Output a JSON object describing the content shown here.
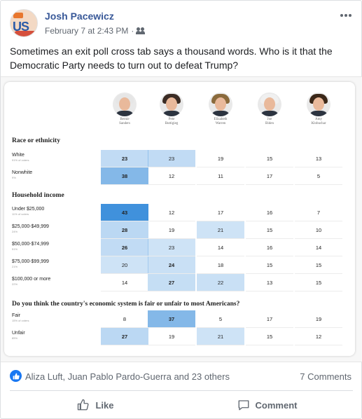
{
  "post": {
    "author": "Josh Pacewicz",
    "timestamp": "February 7 at 2:43 PM",
    "separator": "·",
    "audience_icon": "friends-icon",
    "text": "Sometimes an exit poll cross tab says a thousand words. Who is it that the Democratic Party needs to turn out to defeat Trump?"
  },
  "image": {
    "candidates": [
      {
        "first": "Bernie",
        "last": "Sanders",
        "hair": "#e6e6e6"
      },
      {
        "first": "Pete",
        "last": "Buttigieg",
        "hair": "#3b2c24"
      },
      {
        "first": "Elizabeth",
        "last": "Warren",
        "hair": "#8a6a3c"
      },
      {
        "first": "Joe",
        "last": "Biden",
        "hair": "#f0f0f0"
      },
      {
        "first": "Amy",
        "last": "Klobuchar",
        "hair": "#3a2718"
      }
    ],
    "sections": {
      "race": "Race or ethnicity",
      "income": "Household income",
      "economy": "Do you think the country's economic system is fair or unfair to most Americans?"
    },
    "rows": [
      {
        "label": "White",
        "sub": "91% of voters",
        "values": [
          "23",
          "23",
          "19",
          "15",
          "13"
        ],
        "shade": [
          0.28,
          0.28,
          0,
          0,
          0
        ],
        "bold": [
          true,
          false,
          false,
          false,
          false
        ]
      },
      {
        "label": "Nonwhite",
        "sub": "9%",
        "values": [
          "38",
          "12",
          "11",
          "17",
          "5"
        ],
        "shade": [
          0.55,
          0,
          0,
          0,
          0
        ],
        "bold": [
          true,
          false,
          false,
          false,
          false
        ]
      },
      {
        "label": "Under $25,000",
        "sub": "11% of voters",
        "values": [
          "43",
          "12",
          "17",
          "16",
          "7"
        ],
        "shade": [
          0.85,
          0,
          0,
          0,
          0
        ],
        "bold": [
          true,
          false,
          false,
          false,
          false
        ]
      },
      {
        "label": "$25,000-$49,999",
        "sub": "24%",
        "values": [
          "28",
          "19",
          "21",
          "15",
          "10"
        ],
        "shade": [
          0.3,
          0,
          0.22,
          0,
          0
        ],
        "bold": [
          true,
          false,
          false,
          false,
          false
        ]
      },
      {
        "label": "$50,000-$74,999",
        "sub": "51%",
        "values": [
          "26",
          "23",
          "14",
          "16",
          "14"
        ],
        "shade": [
          0.28,
          0.22,
          0,
          0,
          0
        ],
        "bold": [
          true,
          false,
          false,
          false,
          false
        ]
      },
      {
        "label": "$75,000-$99,999",
        "sub": "21%",
        "values": [
          "20",
          "24",
          "18",
          "15",
          "15"
        ],
        "shade": [
          0.22,
          0.24,
          0,
          0,
          0
        ],
        "bold": [
          false,
          true,
          false,
          false,
          false
        ]
      },
      {
        "label": "$100,000 or more",
        "sub": "22%",
        "values": [
          "14",
          "27",
          "22",
          "13",
          "15"
        ],
        "shade": [
          0,
          0.26,
          0.24,
          0,
          0
        ],
        "bold": [
          false,
          true,
          false,
          false,
          false
        ]
      },
      {
        "label": "Fair",
        "sub": "15% of voters",
        "values": [
          "8",
          "37",
          "5",
          "17",
          "19"
        ],
        "shade": [
          0,
          0.55,
          0,
          0,
          0
        ],
        "bold": [
          false,
          true,
          false,
          false,
          false
        ]
      },
      {
        "label": "Unfair",
        "sub": "85%",
        "values": [
          "27",
          "19",
          "21",
          "15",
          "12"
        ],
        "shade": [
          0.3,
          0,
          0.22,
          0,
          0
        ],
        "bold": [
          true,
          false,
          false,
          false,
          false
        ]
      }
    ],
    "shade_color": "#1f7ed6"
  },
  "engagement": {
    "reactors": "Aliza Luft, Juan Pablo Pardo-Guerra and 23 others",
    "comments": "7 Comments",
    "like_label": "Like",
    "comment_label": "Comment"
  },
  "colors": {
    "link": "#385898",
    "muted": "#606770",
    "like_blue": "#1877f2"
  }
}
